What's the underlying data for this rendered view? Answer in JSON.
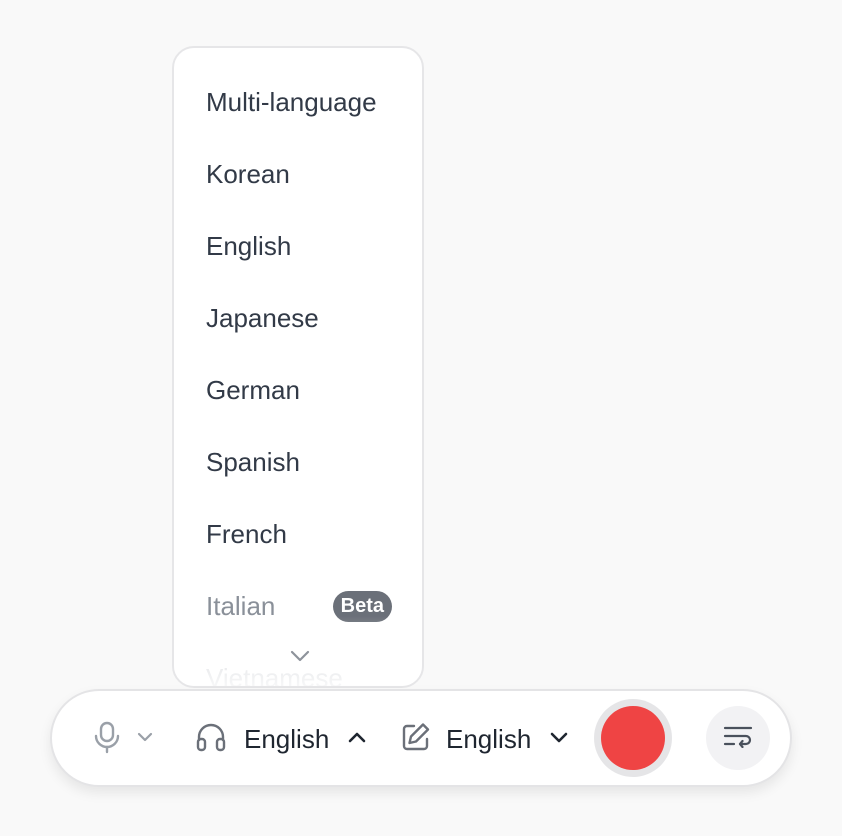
{
  "language_menu": {
    "items": [
      {
        "label": "Multi-language"
      },
      {
        "label": "Korean"
      },
      {
        "label": "English"
      },
      {
        "label": "Japanese"
      },
      {
        "label": "German"
      },
      {
        "label": "Spanish"
      },
      {
        "label": "French"
      },
      {
        "label": "Italian",
        "badge": "Beta"
      },
      {
        "label": "Vietnamese"
      }
    ],
    "scroll_icon": "chevron-down-icon"
  },
  "toolbar": {
    "mic_icon": "microphone-icon",
    "listen_icon": "headphones-icon",
    "listen_language": "English",
    "write_icon": "edit-icon",
    "write_language": "English",
    "record_color": "#ef4444",
    "wrap_icon": "text-wrap-icon"
  }
}
